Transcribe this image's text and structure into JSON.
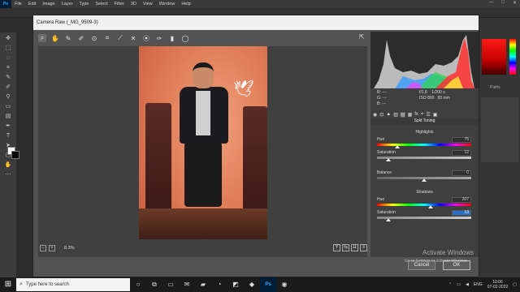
{
  "photoshop": {
    "logo": "Ps",
    "menu": [
      "File",
      "Edit",
      "Image",
      "Layer",
      "Type",
      "Select",
      "Filter",
      "3D",
      "View",
      "Window",
      "Help"
    ],
    "window_controls": [
      "—",
      "□",
      "✕"
    ],
    "paths_tab": "Paths"
  },
  "dialog": {
    "title": "Camera Raw (_MG_9509-3)",
    "zoom": "8.3%",
    "info": {
      "r": "R:",
      "g": "G:",
      "b": "B:",
      "r_val": "---",
      "g_val": "---",
      "b_val": "---",
      "aperture": "f/1.8",
      "shutter": "1/200 s",
      "iso": "ISO 800",
      "focal": "50 mm"
    },
    "panel_title": "Split Toning",
    "highlights": {
      "title": "Highlights",
      "hue_label": "Hue",
      "hue_value": "75",
      "sat_label": "Saturation",
      "sat_value": "12"
    },
    "balance": {
      "label": "Balance",
      "value": "0"
    },
    "shadows": {
      "title": "Shadows",
      "hue_label": "Hue",
      "hue_value": "207",
      "sat_label": "Saturation",
      "sat_value": "13"
    },
    "cancel_label": "Cancel",
    "ok_label": "OK"
  },
  "watermark": {
    "title": "Activate Windows",
    "subtitle": "Go to Settings to activate Windows."
  },
  "taskbar": {
    "search_placeholder": "Type here to search",
    "lang": "ENG",
    "time": "10:06",
    "date": "07-02-2022"
  }
}
